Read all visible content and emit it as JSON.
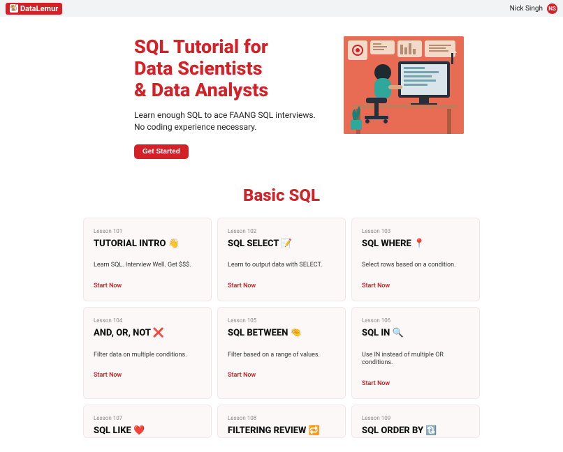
{
  "topbar": {
    "logo_text": "DataLemur",
    "user_name": "Nick Singh",
    "user_initials": "NS"
  },
  "hero": {
    "title_l1": "SQL Tutorial for",
    "title_l2": "Data Scientists",
    "title_l3": "& Data Analysts",
    "subtitle": "Learn enough SQL to ace FAANG SQL interviews. No coding experience necessary.",
    "cta": "Get Started"
  },
  "section_title": "Basic SQL",
  "start_label": "Start Now",
  "cards": [
    {
      "tag": "Lesson 101",
      "title": "TUTORIAL INTRO 👋",
      "desc": "Learn SQL. Interview Well. Get $$$."
    },
    {
      "tag": "Lesson 102",
      "title": "SQL SELECT 📝",
      "desc": "Learn to output data with SELECT."
    },
    {
      "tag": "Lesson 103",
      "title": "SQL WHERE 📍",
      "desc": "Select rows based on a condition."
    },
    {
      "tag": "Lesson 104",
      "title": "AND, OR, NOT ❌",
      "desc": "Filter data on multiple conditions."
    },
    {
      "tag": "Lesson 105",
      "title": "SQL BETWEEN 🤏",
      "desc": "Filter based on a range of values."
    },
    {
      "tag": "Lesson 106",
      "title": "SQL IN 🔍",
      "desc": "Use IN instead of multiple OR conditions."
    },
    {
      "tag": "Lesson 107",
      "title": "SQL LIKE ❤️",
      "desc": ""
    },
    {
      "tag": "Lesson 108",
      "title": "FILTERING REVIEW 🔁",
      "desc": ""
    },
    {
      "tag": "Lesson 109",
      "title": "SQL ORDER BY 🔃",
      "desc": ""
    }
  ]
}
